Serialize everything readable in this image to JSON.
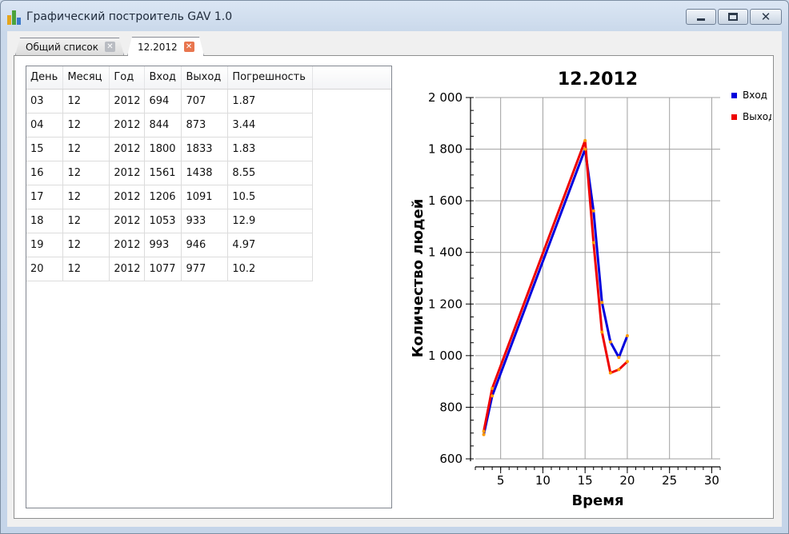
{
  "window": {
    "title": "Графический построитель GAV 1.0",
    "min_glyph": "minimize-icon",
    "max_glyph": "maximize-icon",
    "close_glyph": "✕"
  },
  "tabs": [
    {
      "label": "Общий список",
      "active": false,
      "close_icon": "✕",
      "close_color": "#b9bcc2"
    },
    {
      "label": "12.2012",
      "active": true,
      "close_icon": "✕",
      "close_color": "#e8764f"
    }
  ],
  "table": {
    "columns": [
      "День",
      "Месяц",
      "Год",
      "Вход",
      "Выход",
      "Погрешность"
    ],
    "rows": [
      [
        "03",
        "12",
        "2012",
        "694",
        "707",
        "1.87"
      ],
      [
        "04",
        "12",
        "2012",
        "844",
        "873",
        "3.44"
      ],
      [
        "15",
        "12",
        "2012",
        "1800",
        "1833",
        "1.83"
      ],
      [
        "16",
        "12",
        "2012",
        "1561",
        "1438",
        "8.55"
      ],
      [
        "17",
        "12",
        "2012",
        "1206",
        "1091",
        "10.5"
      ],
      [
        "18",
        "12",
        "2012",
        "1053",
        "933",
        "12.9"
      ],
      [
        "19",
        "12",
        "2012",
        "993",
        "946",
        "4.97"
      ],
      [
        "20",
        "12",
        "2012",
        "1077",
        "977",
        "10.2"
      ]
    ]
  },
  "chart_data": {
    "type": "line",
    "title": "12.2012",
    "xlabel": "Время",
    "ylabel": "Количество людей",
    "xlim": [
      2,
      31
    ],
    "ylim": [
      600,
      2000
    ],
    "xticks": [
      5,
      10,
      15,
      20,
      25,
      30
    ],
    "yticks": [
      600,
      800,
      1000,
      1200,
      1400,
      1600,
      1800,
      2000
    ],
    "ytick_labels": [
      "600",
      "800",
      "1 000",
      "1 200",
      "1 400",
      "1 600",
      "1 800",
      "2 000"
    ],
    "grid": true,
    "legend_position": "top-right",
    "x": [
      3,
      4,
      15,
      16,
      17,
      18,
      19,
      20
    ],
    "series": [
      {
        "name": "Вход",
        "color": "#0000dd",
        "values": [
          694,
          844,
          1800,
          1561,
          1206,
          1053,
          993,
          1077
        ]
      },
      {
        "name": "Выход",
        "color": "#ee0000",
        "values": [
          707,
          873,
          1833,
          1438,
          1091,
          933,
          946,
          977
        ]
      }
    ],
    "marker_color": "#ff9a00"
  }
}
